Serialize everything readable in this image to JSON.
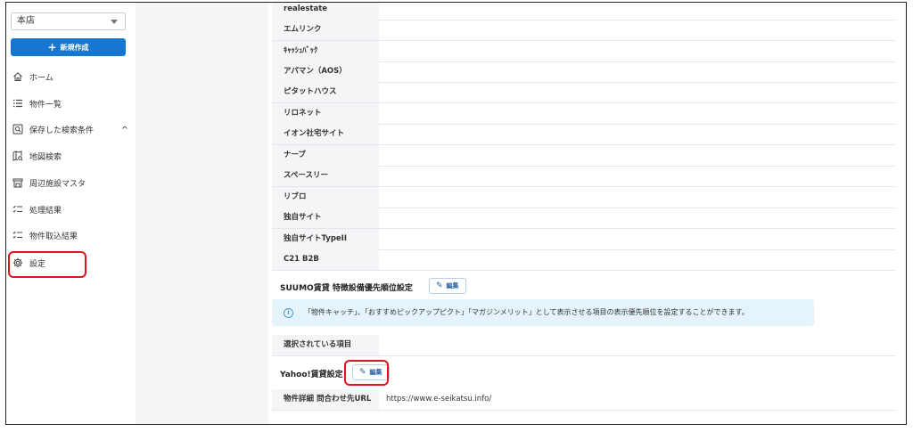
{
  "sidebar": {
    "store_select": "本店",
    "new_button": "新規作成",
    "items": [
      {
        "label": "ホーム",
        "icon": "home-icon"
      },
      {
        "label": "物件一覧",
        "icon": "list-icon"
      },
      {
        "label": "保存した検索条件",
        "icon": "saved-search-icon",
        "expand": "^"
      },
      {
        "label": "地図検索",
        "icon": "map-search-icon"
      },
      {
        "label": "周辺施設マスタ",
        "icon": "facility-icon"
      },
      {
        "label": "処理結果",
        "icon": "checklist-icon"
      },
      {
        "label": "物件取込結果",
        "icon": "checklist-icon"
      },
      {
        "label": "設定",
        "icon": "gear-icon"
      }
    ]
  },
  "portal_rows": [
    "realestate",
    "エムリンク",
    "ｷｬｯｼｭﾊﾞｯｸ",
    "アパマン（AOS）",
    "ピタットハウス",
    "リロネット",
    "イオン社宅サイト",
    "ナーブ",
    "スペースリー",
    "リブロ",
    "独自サイト",
    "独自サイトTypeII",
    "C21 B2B"
  ],
  "suumo": {
    "title": "SUUMO賃貸 特徴設備優先順位設定",
    "edit_label": "編集",
    "info_text": "「物件キャッチ」、「おすすめピックアップピクト」「マガジンメリット」として表示させる項目の表示優先順位を設定することができます。",
    "selected_label": "選択されている項目"
  },
  "yahoo": {
    "title": "Yahoo!賃貸設定",
    "edit_label": "編集",
    "url_label": "物件詳細 問合わせ先URL",
    "url_value": "https://www.e-seikatsu.info/"
  },
  "colors": {
    "primary": "#1677d2",
    "highlight": "#e0141e",
    "info_bg": "#e5f3fb"
  }
}
